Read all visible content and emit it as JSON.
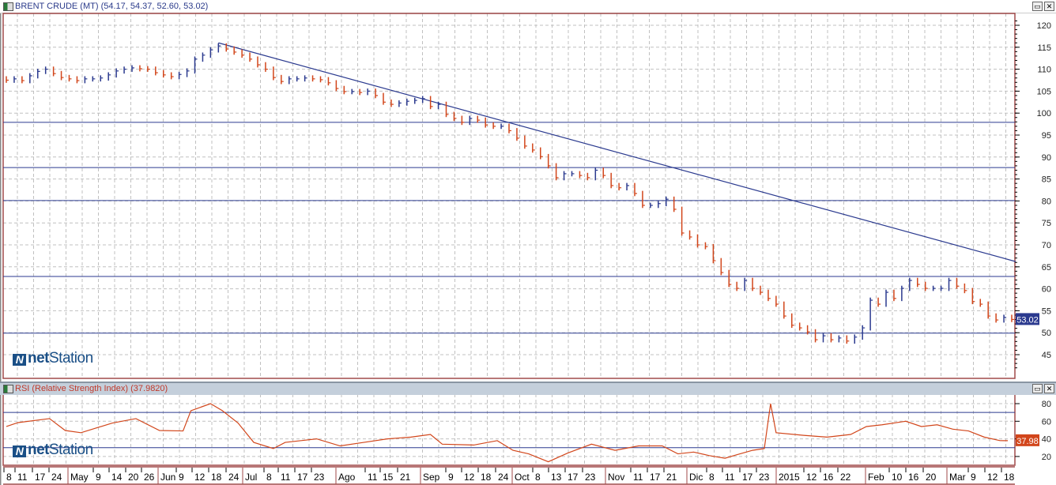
{
  "main_panel": {
    "title": "BRENT CRUDE (MT) (54.17, 54.37, 52.60, 53.02)",
    "last_value_label": "53.02"
  },
  "rsi_panel": {
    "title": "RSI (Relative Strength Index) (37.9820)",
    "last_value_label": "37.98"
  },
  "watermark": {
    "prefix": "net",
    "suffix": "Station"
  },
  "window_buttons": {
    "maximize": "▭",
    "close": "✕"
  },
  "colors": {
    "up": "#2b3a8f",
    "down": "#d2461b",
    "frame": "#a04a4a",
    "rsi_line": "#d2461b",
    "level_line": "#2b3a8f",
    "grid": "#c0c0c0"
  },
  "chart_data": [
    {
      "type": "ohlc",
      "title": "BRENT CRUDE (MT)",
      "ylim": [
        41,
        123
      ],
      "yticks": [
        45,
        50,
        55,
        60,
        65,
        70,
        75,
        80,
        85,
        90,
        95,
        100,
        105,
        110,
        115,
        120
      ],
      "last": {
        "open": 54.17,
        "high": 54.37,
        "low": 52.6,
        "close": 53.02
      },
      "closes": [
        107.5,
        107.8,
        107.4,
        108.5,
        109.5,
        110,
        109,
        108.1,
        107.8,
        107.4,
        107.8,
        107.8,
        108,
        108.7,
        109.6,
        110,
        110.3,
        110.1,
        110,
        109.2,
        108.7,
        108.3,
        108.8,
        109.6,
        112.3,
        113.2,
        114.4,
        115.3,
        114.6,
        113.9,
        113.2,
        112.3,
        111,
        110,
        108.1,
        107.2,
        107.8,
        107.8,
        108,
        107.8,
        107.6,
        106.9,
        105.6,
        104.9,
        104.9,
        104.7,
        105,
        104,
        102.5,
        102,
        102.3,
        102.7,
        102.9,
        103.3,
        101.5,
        102,
        99.7,
        98.8,
        97.9,
        98.8,
        98.4,
        97.3,
        97,
        97,
        96,
        94.3,
        92.5,
        91.6,
        90.1,
        88,
        85.3,
        86.2,
        86.2,
        85.8,
        85.3,
        87,
        85.8,
        83.5,
        83,
        83.5,
        81.7,
        79,
        79,
        79.4,
        80.4,
        78.1,
        72.7,
        71.8,
        70,
        69.6,
        66.4,
        63.7,
        61,
        60.1,
        61.9,
        60.1,
        59.2,
        57.8,
        56.5,
        53.8,
        51.7,
        51.1,
        50.2,
        48.4,
        49.3,
        48.4,
        48.8,
        48.1,
        49,
        51.1,
        57.4,
        56.5,
        59.2,
        57.8,
        60.1,
        61.9,
        61,
        60.1,
        60.1,
        60.1,
        61.9,
        60.6,
        59.6,
        57.1,
        56.5,
        53.8,
        52.9,
        53.5,
        53.02
      ],
      "horizontal_levels": [
        97.9,
        87.6,
        80.1,
        62.8,
        49.9
      ],
      "trendline": {
        "start_index": 27,
        "start_value": 116,
        "end_index": 128.5,
        "end_value": 66.2
      }
    },
    {
      "type": "line",
      "title": "RSI (Relative Strength Index)",
      "ylim": [
        3,
        90
      ],
      "yticks": [
        20,
        40,
        60,
        80
      ],
      "levels": [
        70,
        30
      ],
      "points": [
        [
          0,
          54
        ],
        [
          1.5,
          58.5
        ],
        [
          5.5,
          63
        ],
        [
          7.5,
          49.5
        ],
        [
          9.5,
          47
        ],
        [
          13.5,
          58
        ],
        [
          16.5,
          63
        ],
        [
          19.5,
          49.5
        ],
        [
          22.5,
          49
        ],
        [
          23.5,
          72
        ],
        [
          26,
          80
        ],
        [
          27.5,
          72
        ],
        [
          29.5,
          58
        ],
        [
          31.5,
          36
        ],
        [
          34,
          29
        ],
        [
          35.5,
          36
        ],
        [
          39.5,
          40
        ],
        [
          42.5,
          32
        ],
        [
          45.5,
          36
        ],
        [
          48.5,
          40
        ],
        [
          51.5,
          42
        ],
        [
          54,
          45
        ],
        [
          55.5,
          34
        ],
        [
          59.5,
          33
        ],
        [
          62.5,
          38
        ],
        [
          64.5,
          27
        ],
        [
          66.5,
          23
        ],
        [
          69,
          14
        ],
        [
          71.5,
          24
        ],
        [
          74.5,
          34
        ],
        [
          77.5,
          27
        ],
        [
          80.5,
          32
        ],
        [
          83.5,
          32
        ],
        [
          85.5,
          23
        ],
        [
          87.5,
          25
        ],
        [
          89.5,
          21
        ],
        [
          91.5,
          18
        ],
        [
          93,
          22
        ],
        [
          95,
          27
        ],
        [
          96.5,
          29
        ],
        [
          97.3,
          80
        ],
        [
          98,
          47
        ],
        [
          101.5,
          44
        ],
        [
          104.5,
          42
        ],
        [
          107.5,
          45
        ],
        [
          109.5,
          54
        ],
        [
          111.5,
          56
        ],
        [
          114.5,
          60
        ],
        [
          116.5,
          54
        ],
        [
          118.5,
          56
        ],
        [
          120.5,
          51
        ],
        [
          122.5,
          49
        ],
        [
          124.5,
          42
        ],
        [
          126.5,
          38
        ],
        [
          127.5,
          37.98
        ]
      ]
    }
  ],
  "x_axis": {
    "labels": [
      "8",
      "11",
      "17",
      "24",
      "May",
      "9",
      "14",
      "20",
      "26",
      "Jun",
      "9",
      "12",
      "18",
      "24",
      "Jul",
      "8",
      "11",
      "17",
      "23",
      "Ago",
      "11",
      "15",
      "21",
      "Sep",
      "9",
      "12",
      "18",
      "24",
      "Oct",
      "8",
      "13",
      "17",
      "23",
      "Nov",
      "11",
      "17",
      "21",
      "Dic",
      "8",
      "11",
      "17",
      "23",
      "2015",
      "12",
      "16",
      "22",
      "Feb",
      "10",
      "16",
      "20",
      "Mar",
      "9",
      "12",
      "18"
    ]
  }
}
